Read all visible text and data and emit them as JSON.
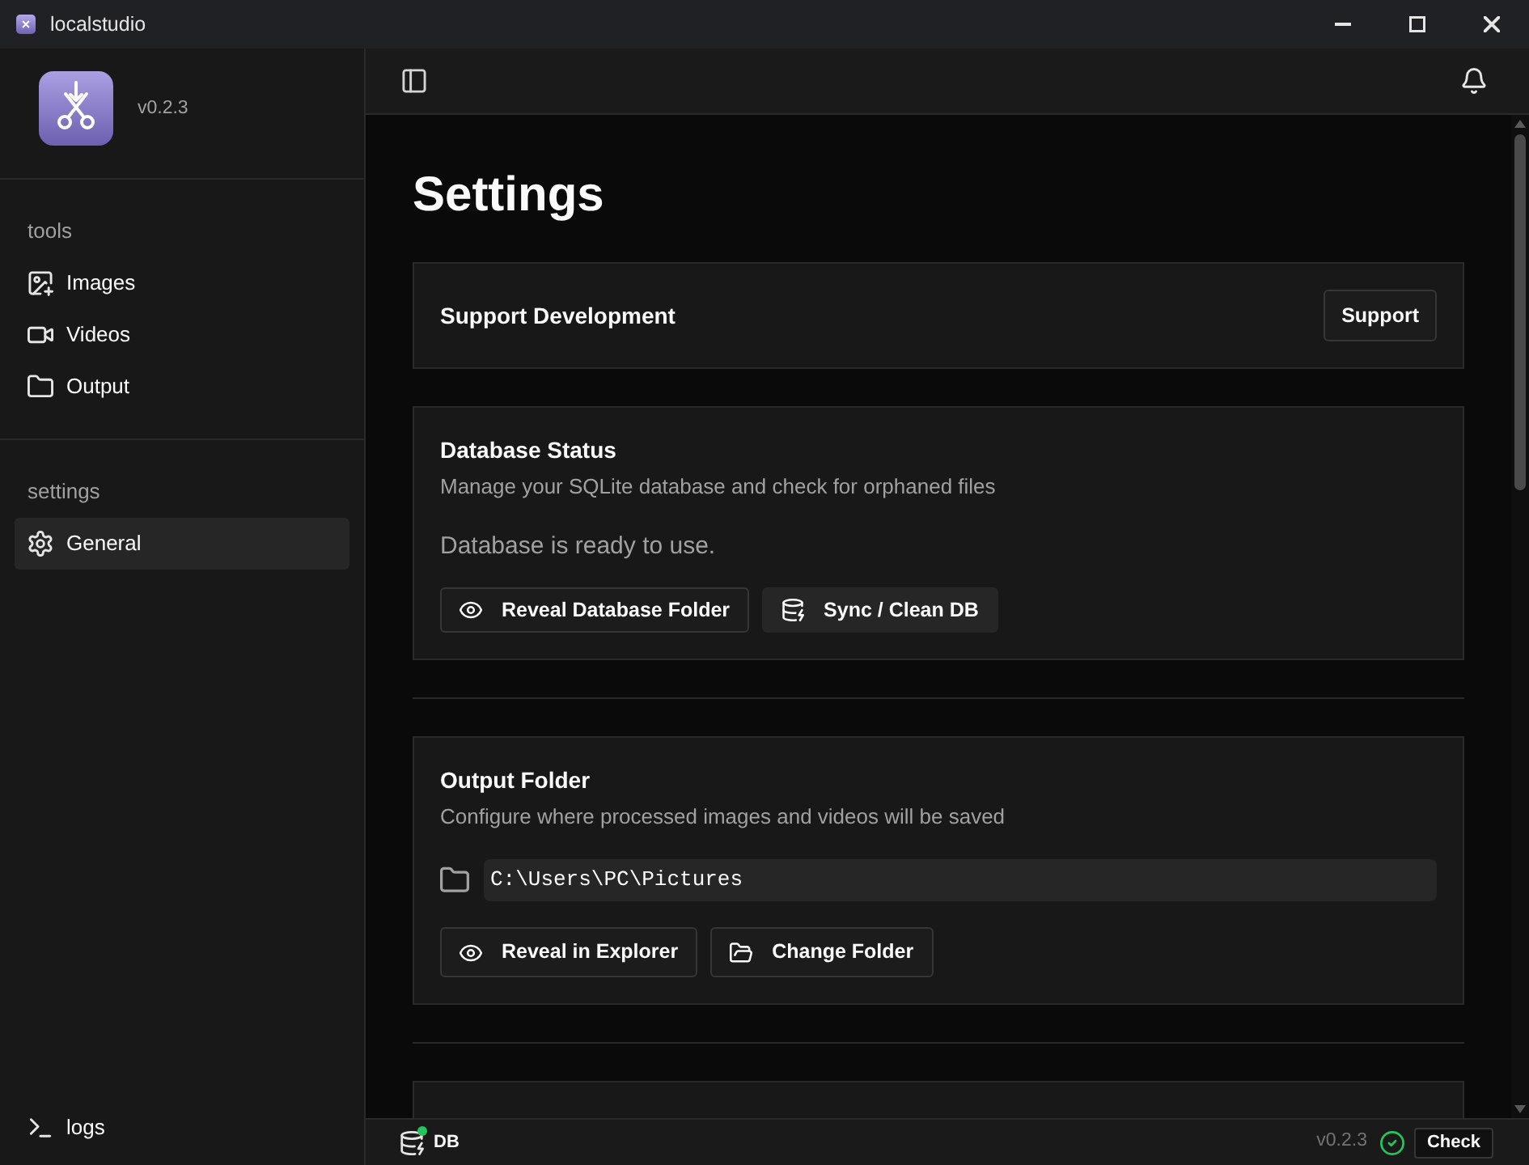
{
  "window": {
    "title": "localstudio"
  },
  "sidebar": {
    "version": "v0.2.3",
    "sections": [
      {
        "label": "tools",
        "items": [
          {
            "label": "Images",
            "selected": false
          },
          {
            "label": "Videos",
            "selected": false
          },
          {
            "label": "Output",
            "selected": false
          }
        ]
      },
      {
        "label": "settings",
        "items": [
          {
            "label": "General",
            "selected": true
          }
        ]
      }
    ],
    "footer_item": {
      "label": "logs"
    }
  },
  "page": {
    "title": "Settings",
    "groups": [
      {
        "cards": [
          {
            "kind": "action",
            "title": "Support Development",
            "buttons": [
              {
                "label": "Support",
                "kind": "outline"
              }
            ]
          },
          {
            "kind": "database",
            "title": "Database Status",
            "description": "Manage your SQLite database and check for orphaned files",
            "status": "Database is ready to use.",
            "buttons": [
              {
                "label": "Reveal Database Folder",
                "kind": "outline"
              },
              {
                "label": "Sync / Clean DB",
                "kind": "secondary"
              }
            ]
          }
        ]
      },
      {
        "cards": [
          {
            "kind": "folder",
            "title": "Output Folder",
            "description": "Configure where processed images and videos will be saved",
            "path": "C:\\Users\\PC\\Pictures",
            "buttons": [
              {
                "label": "Reveal in Explorer",
                "kind": "outline"
              },
              {
                "label": "Change Folder",
                "kind": "outline"
              }
            ]
          }
        ]
      },
      {
        "cards": [
          {
            "kind": "cut_off"
          }
        ]
      }
    ]
  },
  "status_bar": {
    "db": {
      "label": "DB",
      "connected": true
    },
    "version": "v0.2.3",
    "check_button": "Check"
  }
}
